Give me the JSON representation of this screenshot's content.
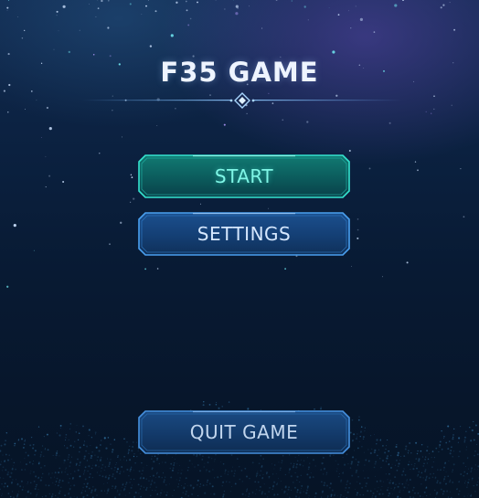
{
  "game": {
    "title": "F35 GAME"
  },
  "menu": {
    "start_label": "START",
    "settings_label": "SETTINGS",
    "quit_label": "QUIT GAME"
  },
  "theme": {
    "start_accent": "#29e0c8",
    "default_accent": "#3f8fe0",
    "background": "#061426"
  }
}
